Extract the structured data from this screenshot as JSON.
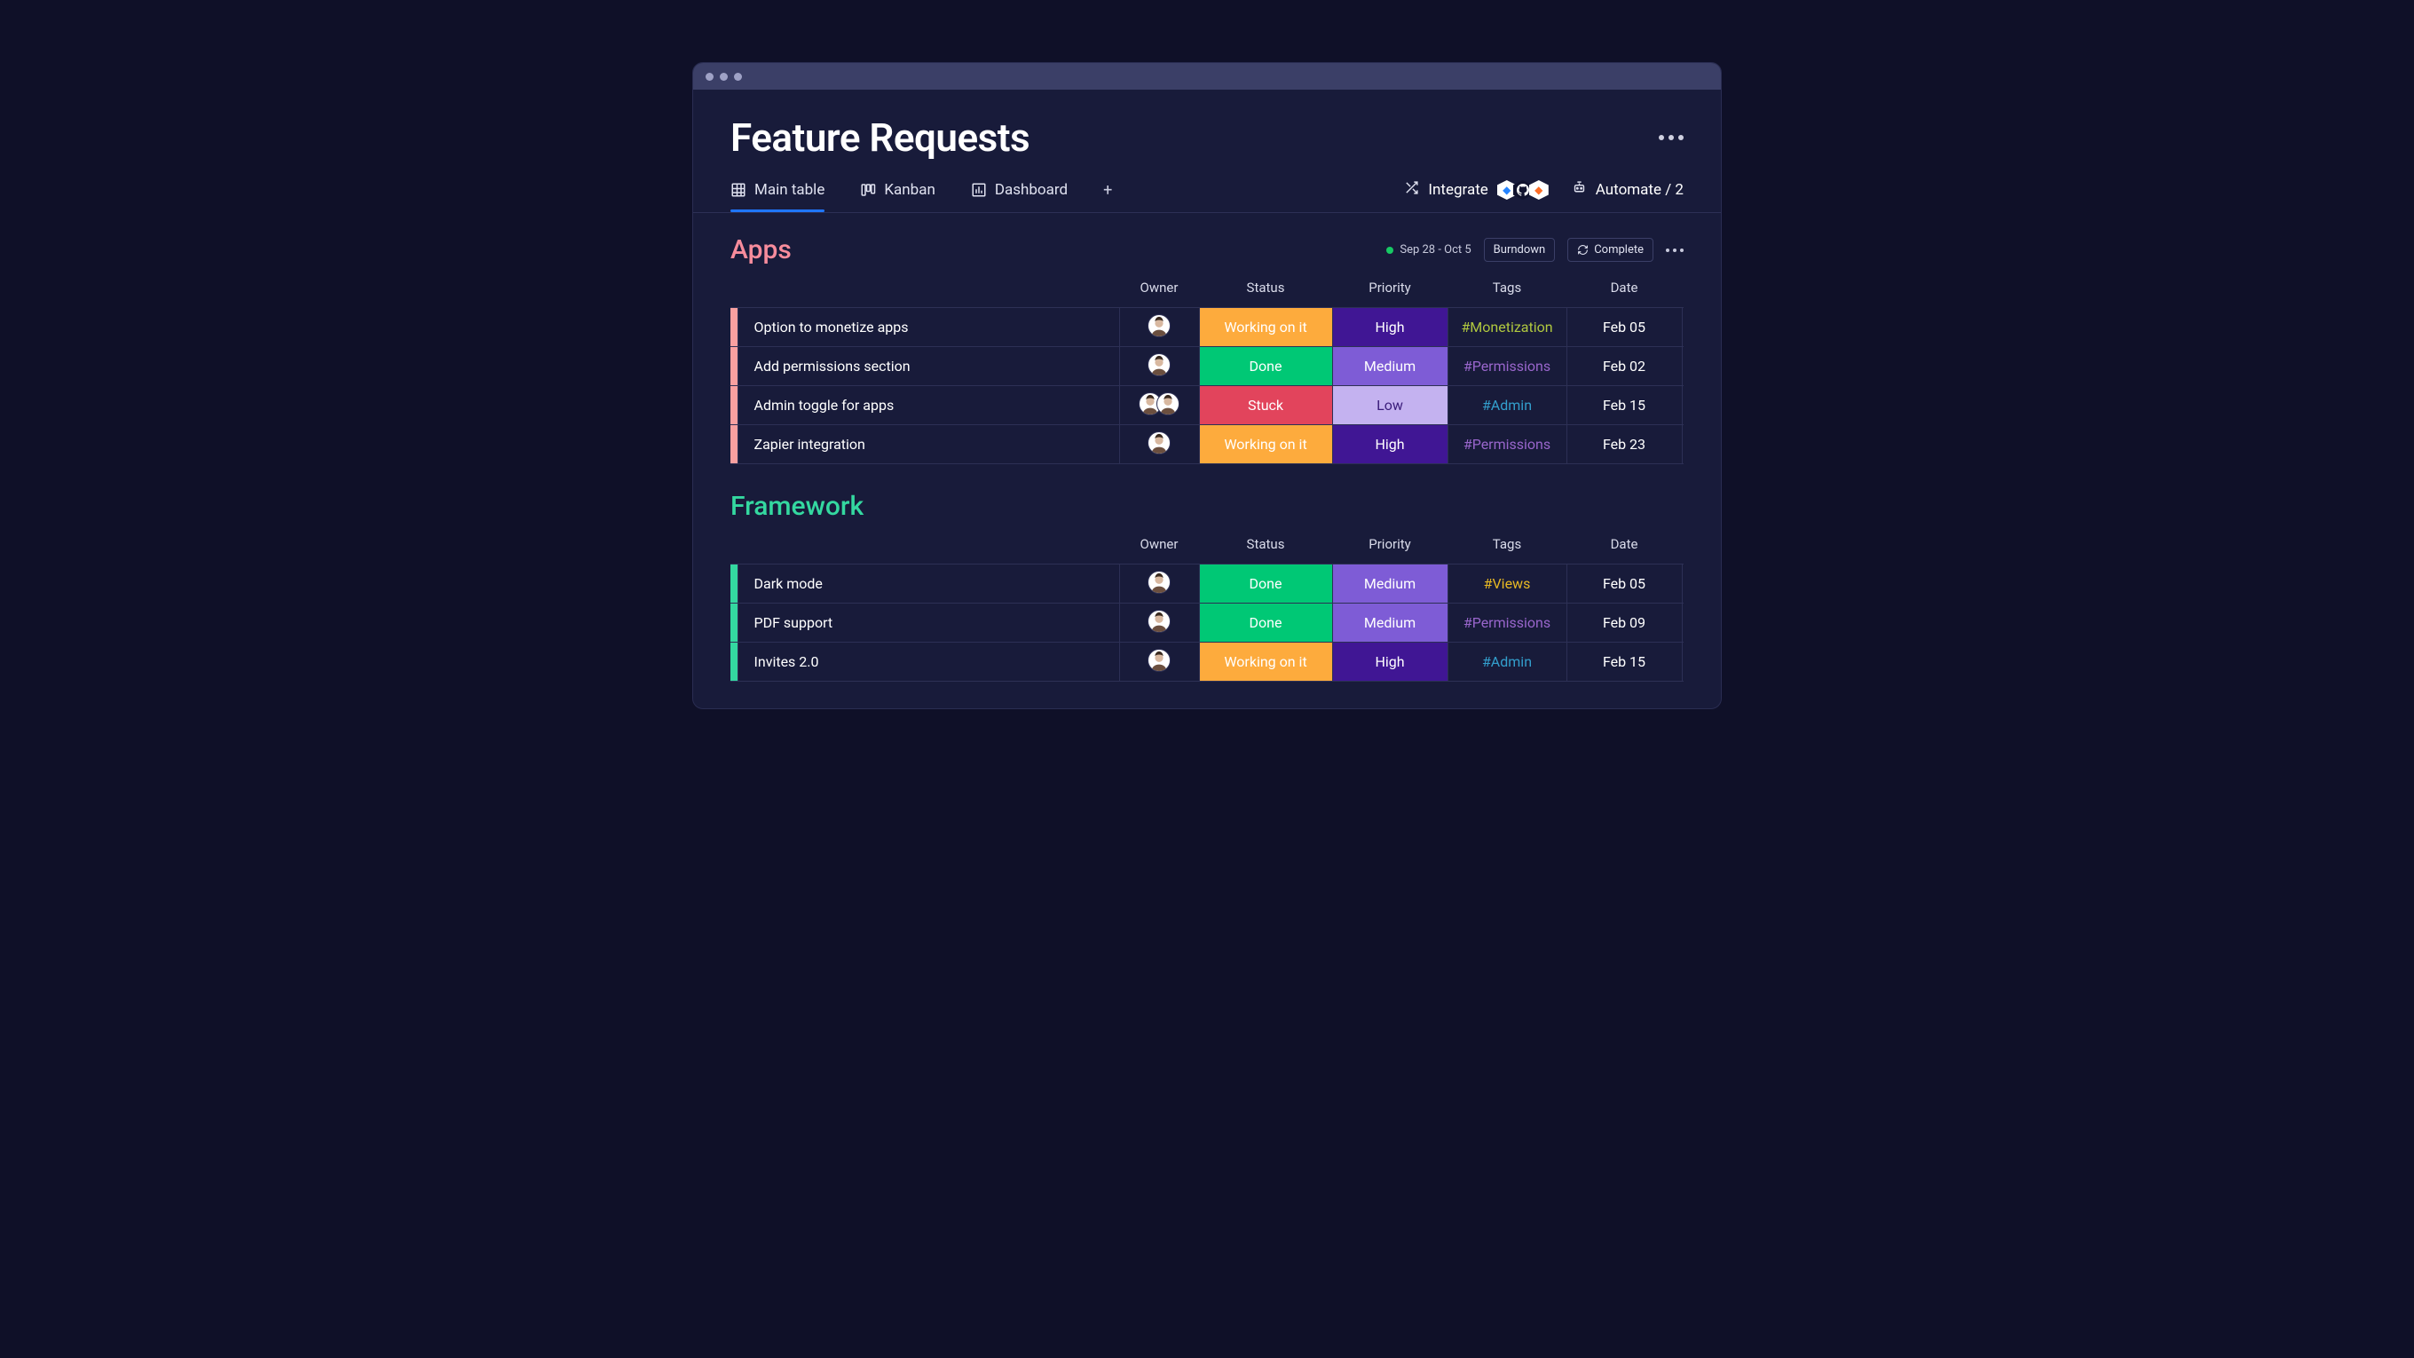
{
  "page": {
    "title": "Feature Requests"
  },
  "tabs": [
    {
      "label": "Main table",
      "icon": "grid-icon",
      "active": true
    },
    {
      "label": "Kanban",
      "icon": "kanban-icon",
      "active": false
    },
    {
      "label": "Dashboard",
      "icon": "dashboard-icon",
      "active": false
    }
  ],
  "actions": {
    "integrate_label": "Integrate",
    "automate_label": "Automate / 2",
    "integrations": [
      "jira",
      "github",
      "gitlab"
    ]
  },
  "status_colors": {
    "Working on it": "#fdab3d",
    "Done": "#00c875",
    "Stuck": "#e2445c"
  },
  "priority_colors": {
    "High": "#401694",
    "Medium": "#7e5cd6",
    "Low": "#c4b2f0"
  },
  "tag_colors": {
    "#Monetization": "#b0c83f",
    "#Permissions": "#9966cc",
    "#Admin": "#339ecc",
    "#Views": "#e8b923"
  },
  "columns": [
    "Owner",
    "Status",
    "Priority",
    "Tags",
    "Date"
  ],
  "groups": [
    {
      "name": "Apps",
      "color": "#f78c9c",
      "accent": "#f9a0a0",
      "date_range": "Sep 28 - Oct 5",
      "buttons": {
        "burndown": "Burndown",
        "complete": "Complete"
      },
      "rows": [
        {
          "title": "Option to monetize apps",
          "owners": 1,
          "status": "Working on it",
          "priority": "High",
          "tag": "#Monetization",
          "date": "Feb 05"
        },
        {
          "title": "Add permissions section",
          "owners": 1,
          "status": "Done",
          "priority": "Medium",
          "tag": "#Permissions",
          "date": "Feb 02"
        },
        {
          "title": "Admin toggle for apps",
          "owners": 2,
          "status": "Stuck",
          "priority": "Low",
          "tag": "#Admin",
          "date": "Feb 15"
        },
        {
          "title": "Zapier integration",
          "owners": 1,
          "status": "Working on it",
          "priority": "High",
          "tag": "#Permissions",
          "date": "Feb 23"
        }
      ]
    },
    {
      "name": "Framework",
      "color": "#34d8a0",
      "accent": "#34d8a0",
      "date_range": "",
      "buttons": null,
      "rows": [
        {
          "title": "Dark mode",
          "owners": 1,
          "status": "Done",
          "priority": "Medium",
          "tag": "#Views",
          "date": "Feb 05"
        },
        {
          "title": "PDF support",
          "owners": 1,
          "status": "Done",
          "priority": "Medium",
          "tag": "#Permissions",
          "date": "Feb 09"
        },
        {
          "title": "Invites 2.0",
          "owners": 1,
          "status": "Working on it",
          "priority": "High",
          "tag": "#Admin",
          "date": "Feb 15"
        }
      ]
    }
  ]
}
